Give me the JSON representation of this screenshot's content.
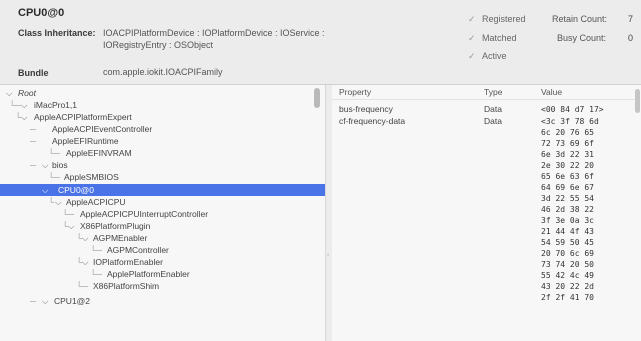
{
  "header": {
    "title": "CPU0@0",
    "class_label": "Class Inheritance:",
    "class_value_line1": "IOACPIPlatformDevice : IOPlatformDevice : IOService :",
    "class_value_line2": "IORegistryEntry : OSObject",
    "bundle_label": "Bundle",
    "bundle_value": "com.apple.iokit.IOACPIFamily",
    "status": [
      "Registered",
      "Matched",
      "Active"
    ],
    "retain_label": "Retain Count:",
    "retain_value": "7",
    "busy_label": "Busy Count:",
    "busy_value": "0"
  },
  "tree": {
    "rows": [
      {
        "label": "Root",
        "italic": true
      },
      {
        "label": "iMacPro1,1"
      },
      {
        "label": "AppleACPIPlatformExpert"
      },
      {
        "label": "AppleACPIEventController"
      },
      {
        "label": "AppleEFIRuntime"
      },
      {
        "label": "AppleEFINVRAM"
      },
      {
        "label": "bios"
      },
      {
        "label": "AppleSMBIOS"
      },
      {
        "label": "CPU0@0",
        "selected": true
      },
      {
        "label": "AppleACPICPU"
      },
      {
        "label": "AppleACPICPUInterruptController"
      },
      {
        "label": "X86PlatformPlugin"
      },
      {
        "label": "AGPMEnabler"
      },
      {
        "label": "AGPMController"
      },
      {
        "label": "IOPlatformEnabler"
      },
      {
        "label": "ApplePlatformEnabler"
      },
      {
        "label": "X86PlatformShim"
      },
      {
        "label": "CPU1@2"
      }
    ]
  },
  "props": {
    "col_property": "Property",
    "col_type": "Type",
    "col_value": "Value",
    "rows": [
      {
        "property": "bus-frequency",
        "type": "Data",
        "value": "<00 84 d7 17>"
      },
      {
        "property": "cf-frequency-data",
        "type": "Data",
        "value": "<3c 3f 78 6d"
      }
    ],
    "hex_lines": [
      "6c 20 76 65",
      "72 73 69 6f",
      "6e 3d 22 31",
      "2e 30 22 20",
      "65 6e 63 6f",
      "64 69 6e 67",
      "3d 22 55 54",
      "46 2d 38 22",
      "3f 3e 0a 3c",
      "21 44 4f 43",
      "54 59 50 45",
      "20 70 6c 69",
      "73 74 20 50",
      "55 42 4c 49",
      "43 20 22 2d",
      "2f 2f 41 70"
    ]
  }
}
